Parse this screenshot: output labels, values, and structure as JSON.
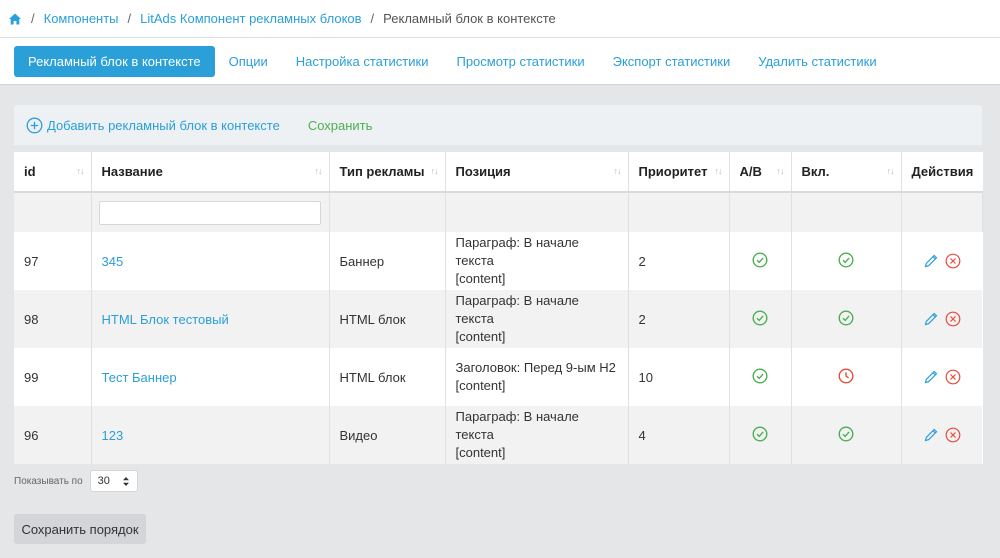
{
  "breadcrumb": {
    "items": [
      "Компоненты",
      "LitAds Компонент рекламных блоков"
    ],
    "current": "Рекламный блок в контексте"
  },
  "tabs": [
    {
      "label": "Рекламный блок в контексте",
      "active": true
    },
    {
      "label": "Опции"
    },
    {
      "label": "Настройка статистики"
    },
    {
      "label": "Просмотр статистики"
    },
    {
      "label": "Экспорт статистики"
    },
    {
      "label": "Удалить статистики"
    }
  ],
  "toolbar": {
    "add_label": "Добавить рекламный блок в контексте",
    "save_label": "Сохранить"
  },
  "table": {
    "columns": [
      "id",
      "Название",
      "Тип рекламы",
      "Позиция",
      "Приоритет",
      "A/B",
      "Вкл.",
      "Действия"
    ],
    "rows": [
      {
        "id": "97",
        "name": "345",
        "type": "Баннер",
        "position_line1": "Параграф: В начале текста",
        "position_line2": "[content]",
        "priority": "2",
        "ab": "check",
        "enabled": "check"
      },
      {
        "id": "98",
        "name": "HTML Блок тестовый",
        "type": "HTML блок",
        "position_line1": "Параграф: В начале текста",
        "position_line2": "[content]",
        "priority": "2",
        "ab": "check",
        "enabled": "check"
      },
      {
        "id": "99",
        "name": "Тест Баннер",
        "type": "HTML блок",
        "position_line1": "Заголовок: Перед 9-ым H2",
        "position_line2": "[content]",
        "priority": "10",
        "ab": "check",
        "enabled": "clock"
      },
      {
        "id": "96",
        "name": "123",
        "type": "Видео",
        "position_line1": "Параграф: В начале текста",
        "position_line2": "[content]",
        "priority": "4",
        "ab": "check",
        "enabled": "check"
      }
    ]
  },
  "pager": {
    "label": "Показывать по",
    "value": "30"
  },
  "save_order_label": "Сохранить порядок",
  "colors": {
    "accent": "#2a9fd8",
    "success": "#4caf50",
    "danger": "#e74c3c"
  }
}
